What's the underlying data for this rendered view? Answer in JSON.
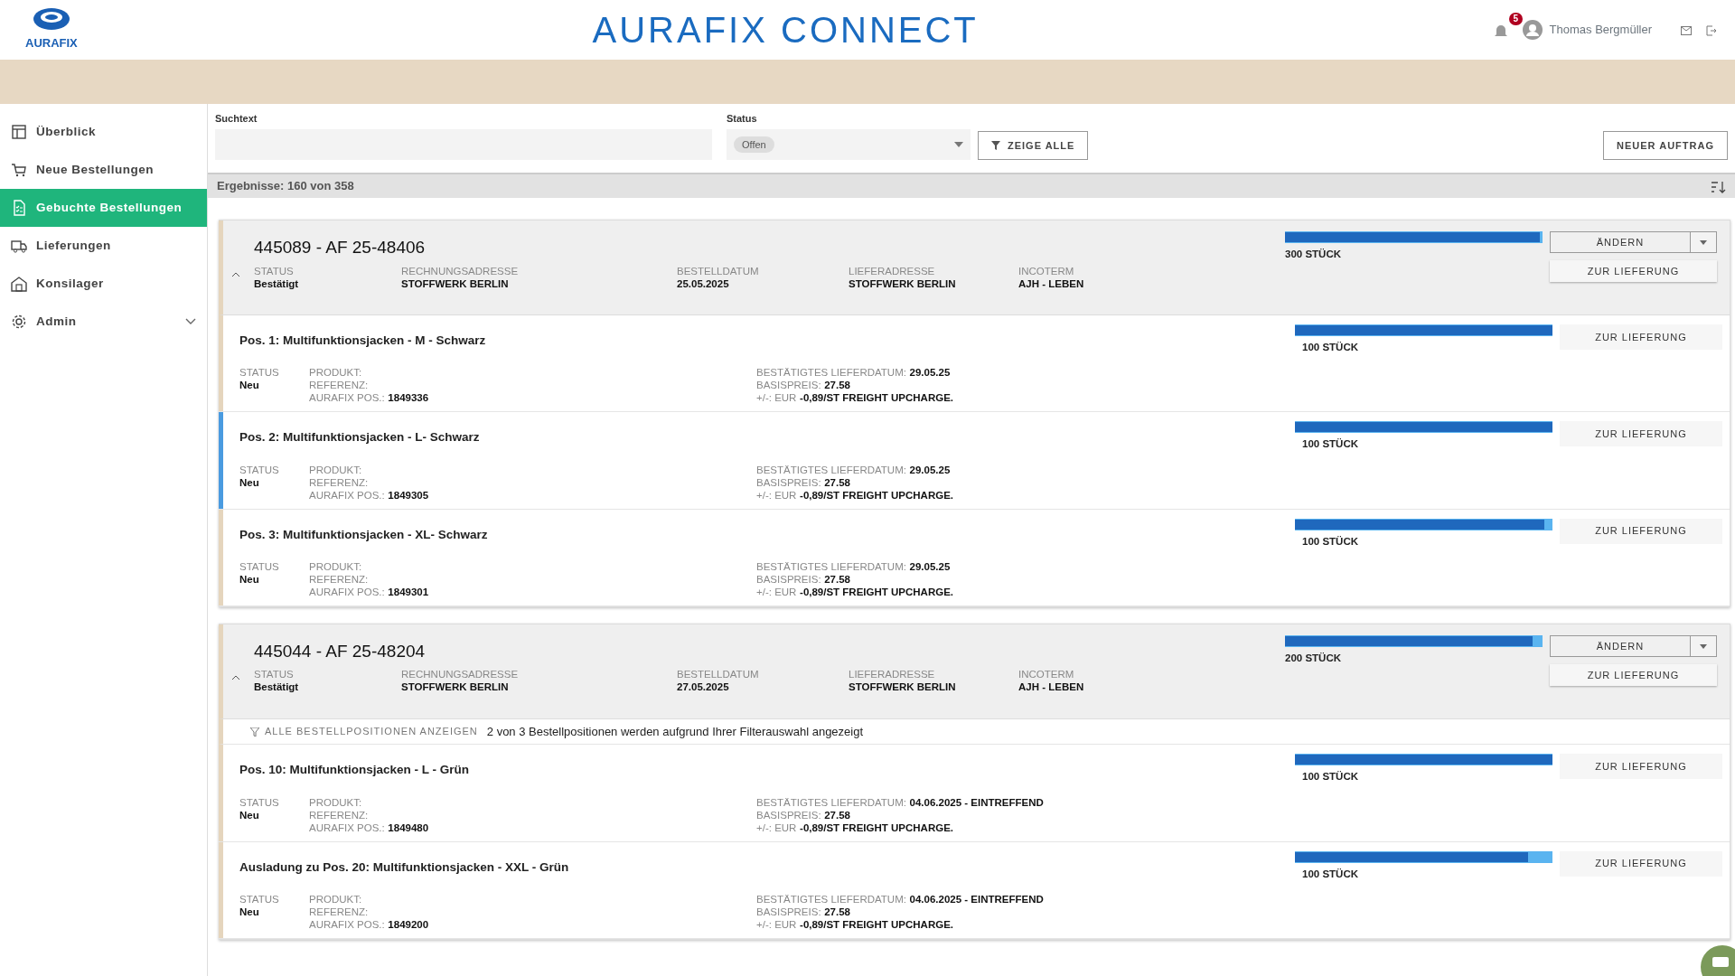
{
  "header": {
    "logo_text": "AURAFIX",
    "title": "AURAFIX CONNECT",
    "notifications": "5",
    "user": "Thomas Bergmüller"
  },
  "sidebar": {
    "items": [
      {
        "label": "Überblick",
        "selected": false
      },
      {
        "label": "Neue Bestellungen",
        "selected": false
      },
      {
        "label": "Gebuchte Bestellungen",
        "selected": true
      },
      {
        "label": "Lieferungen",
        "selected": false
      },
      {
        "label": "Konsilager",
        "selected": false
      },
      {
        "label": "Admin",
        "selected": false,
        "expandable": true
      }
    ]
  },
  "filters": {
    "search": {
      "label": "Suchtext"
    },
    "status": {
      "label": "Status",
      "chip": "Offen"
    },
    "show_all": "ZEIGE ALLE",
    "new_order": "NEUER AUFTRAG"
  },
  "results": "Ergebnisse: 160 von 358",
  "orders": [
    {
      "title": "445089 - AF 25-48406",
      "expanded": true,
      "fields": [
        {
          "label": "STATUS",
          "value": "Bestätigt"
        },
        {
          "label": "RECHNUNGSADRESSE",
          "value": "STOFFWERK BERLIN"
        },
        {
          "label": "BESTELLDATUM",
          "value": "25.05.2025"
        },
        {
          "label": "LIEFERADRESSE",
          "value": "STOFFWERK BERLIN"
        },
        {
          "label": "INCOTERM",
          "value": "AJH - LEBEN"
        }
      ],
      "quantity": "300 STÜCK",
      "level": 0.99,
      "edit_button": "ÄNDERN",
      "delivery_button": "ZUR LIEFERUNG",
      "positions": [
        {
          "title": "Pos. 1: Multifunktionsjacken - M - Schwarz",
          "selected": false,
          "status_label": "STATUS",
          "status": "Neu",
          "product": [
            {
              "label": "PRODUKT:"
            },
            {
              "label": "REFERENZ:"
            },
            {
              "label": "AURAFIX POS.:",
              "value": "1849336"
            }
          ],
          "details": [
            {
              "label": "BESTÄTIGTES LIEFERDATUM:",
              "value": "29.05.25"
            },
            {
              "label": "BASISPREIS:",
              "value": "27.58"
            },
            {
              "label": "+/-: EUR",
              "value": "-0,89/ST FREIGHT UPCHARGE."
            }
          ],
          "quantity": "100 STÜCK",
          "level": 1,
          "button": "ZUR LIEFERUNG"
        },
        {
          "title": "Pos. 2: Multifunktionsjacken - L- Schwarz",
          "selected": true,
          "status_label": "STATUS",
          "status": "Neu",
          "product": [
            {
              "label": "PRODUKT:"
            },
            {
              "label": "REFERENZ:"
            },
            {
              "label": "AURAFIX POS.:",
              "value": "1849305"
            }
          ],
          "details": [
            {
              "label": "BESTÄTIGTES LIEFERDATUM:",
              "value": "29.05.25"
            },
            {
              "label": "BASISPREIS:",
              "value": "27.58"
            },
            {
              "label": "+/-: EUR",
              "value": "-0,89/ST FREIGHT UPCHARGE."
            }
          ],
          "quantity": "100 STÜCK",
          "level": 1,
          "button": "ZUR LIEFERUNG"
        },
        {
          "title": "Pos. 3: Multifunktionsjacken - XL- Schwarz",
          "selected": false,
          "status_label": "STATUS",
          "status": "Neu",
          "product": [
            {
              "label": "PRODUKT:"
            },
            {
              "label": "REFERENZ:"
            },
            {
              "label": "AURAFIX POS.:",
              "value": "1849301"
            }
          ],
          "details": [
            {
              "label": "BESTÄTIGTES LIEFERDATUM:",
              "value": "29.05.25"
            },
            {
              "label": "BASISPREIS:",
              "value": "27.58"
            },
            {
              "label": "+/-: EUR",
              "value": "-0,89/ST FREIGHT UPCHARGE."
            }
          ],
          "quantity": "100 STÜCK",
          "level": 0.97,
          "button": "ZUR LIEFERUNG"
        }
      ]
    },
    {
      "title": "445044 - AF 25-48204",
      "expanded": true,
      "fields": [
        {
          "label": "STATUS",
          "value": "Bestätigt"
        },
        {
          "label": "RECHNUNGSADRESSE",
          "value": "STOFFWERK BERLIN"
        },
        {
          "label": "BESTELLDATUM",
          "value": "27.05.2025"
        },
        {
          "label": "LIEFERADRESSE",
          "value": "STOFFWERK BERLIN"
        },
        {
          "label": "INCOTERM",
          "value": "AJH - LEBEN"
        }
      ],
      "quantity": "200 STÜCK",
      "level": 0.96,
      "edit_button": "ÄNDERN",
      "delivery_button": "ZUR LIEFERUNG",
      "filter_note": {
        "link": "ALLE BESTELLPOSITIONEN ANZEIGEN",
        "text": "2 von 3 Bestellpositionen werden aufgrund Ihrer Filterauswahl angezeigt"
      },
      "positions": [
        {
          "title": "Pos. 10: Multifunktionsjacken - L - Grün",
          "selected": false,
          "status_label": "STATUS",
          "status": "Neu",
          "product": [
            {
              "label": "PRODUKT:"
            },
            {
              "label": "REFERENZ:"
            },
            {
              "label": "AURAFIX POS.:",
              "value": "1849480"
            }
          ],
          "details": [
            {
              "label": "BESTÄTIGTES LIEFERDATUM:",
              "value": "04.06.2025 - EINTREFFEND"
            },
            {
              "label": "BASISPREIS:",
              "value": "27.58"
            },
            {
              "label": "+/-: EUR",
              "value": "-0,89/ST FREIGHT UPCHARGE."
            }
          ],
          "quantity": "100 STÜCK",
          "level": 1,
          "button": "ZUR LIEFERUNG"
        },
        {
          "title": "Ausladung zu Pos. 20: Multifunktionsjacken - XXL - Grün",
          "selected": false,
          "status_label": "STATUS",
          "status": "Neu",
          "product": [
            {
              "label": "PRODUKT:"
            },
            {
              "label": "REFERENZ:"
            },
            {
              "label": "AURAFIX POS.:",
              "value": "1849200"
            }
          ],
          "details": [
            {
              "label": "BESTÄTIGTES LIEFERDATUM:",
              "value": "04.06.2025 - EINTREFFEND"
            },
            {
              "label": "BASISPREIS:",
              "value": "27.58"
            },
            {
              "label": "+/-: EUR",
              "value": "-0,89/ST FREIGHT UPCHARGE."
            }
          ],
          "quantity": "100 STÜCK",
          "level": 0.905,
          "button": "ZUR LIEFERUNG"
        }
      ]
    }
  ]
}
